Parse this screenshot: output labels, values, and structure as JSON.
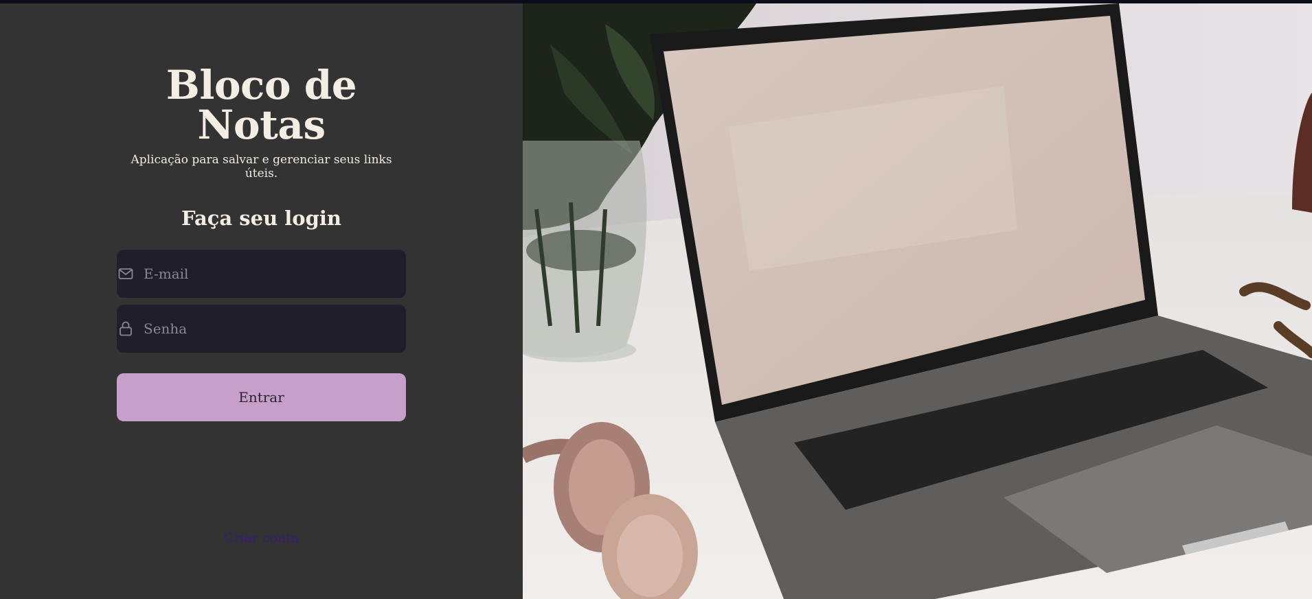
{
  "brand": {
    "title": "Bloco de Notas",
    "subtitle": "Aplicação para salvar e gerenciar seus links úteis."
  },
  "login": {
    "heading": "Faça seu login",
    "email_placeholder": "E-mail",
    "password_placeholder": "Senha",
    "submit_label": "Entrar",
    "create_account_label": "Criar conta"
  },
  "icons": {
    "email": "mail-icon",
    "password": "lock-icon"
  },
  "colors": {
    "panel_bg": "#333333",
    "input_bg": "#201e2a",
    "button_bg": "#c79fcb",
    "text_light": "#f3ede4",
    "link": "#3b1b7a"
  }
}
